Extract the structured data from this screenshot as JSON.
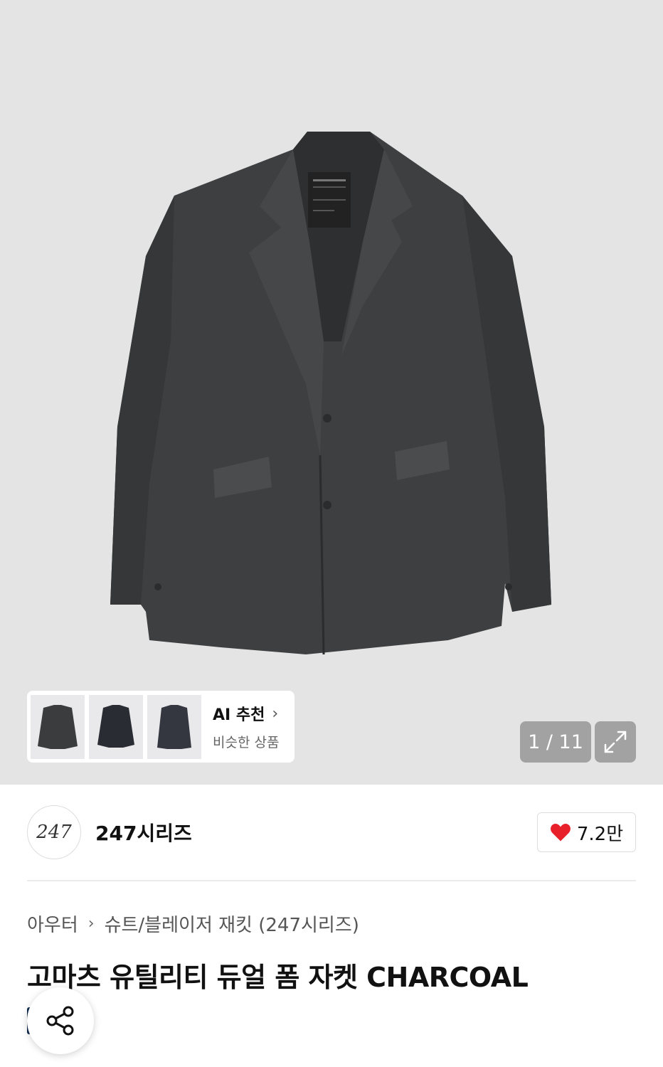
{
  "gallery": {
    "counter": "1 / 11",
    "ai_card": {
      "title": "AI 추천",
      "subtitle": "비슷한 상품"
    }
  },
  "brand": {
    "logo_text": "247",
    "name": "247시리즈",
    "likes": "7.2만"
  },
  "breadcrumb": {
    "level1": "아우터",
    "level2": "슈트/블레이저 재킷 (247시리즈)"
  },
  "product": {
    "title": "고마츠 유틸리티 듀얼 폼 자켓 CHARCOAL",
    "badge": "이"
  },
  "colors": {
    "hero_bg": "#e4e4e4",
    "jacket": "#3d3f40",
    "heart": "#e8202a",
    "badge_bg": "#0f2b4c"
  }
}
